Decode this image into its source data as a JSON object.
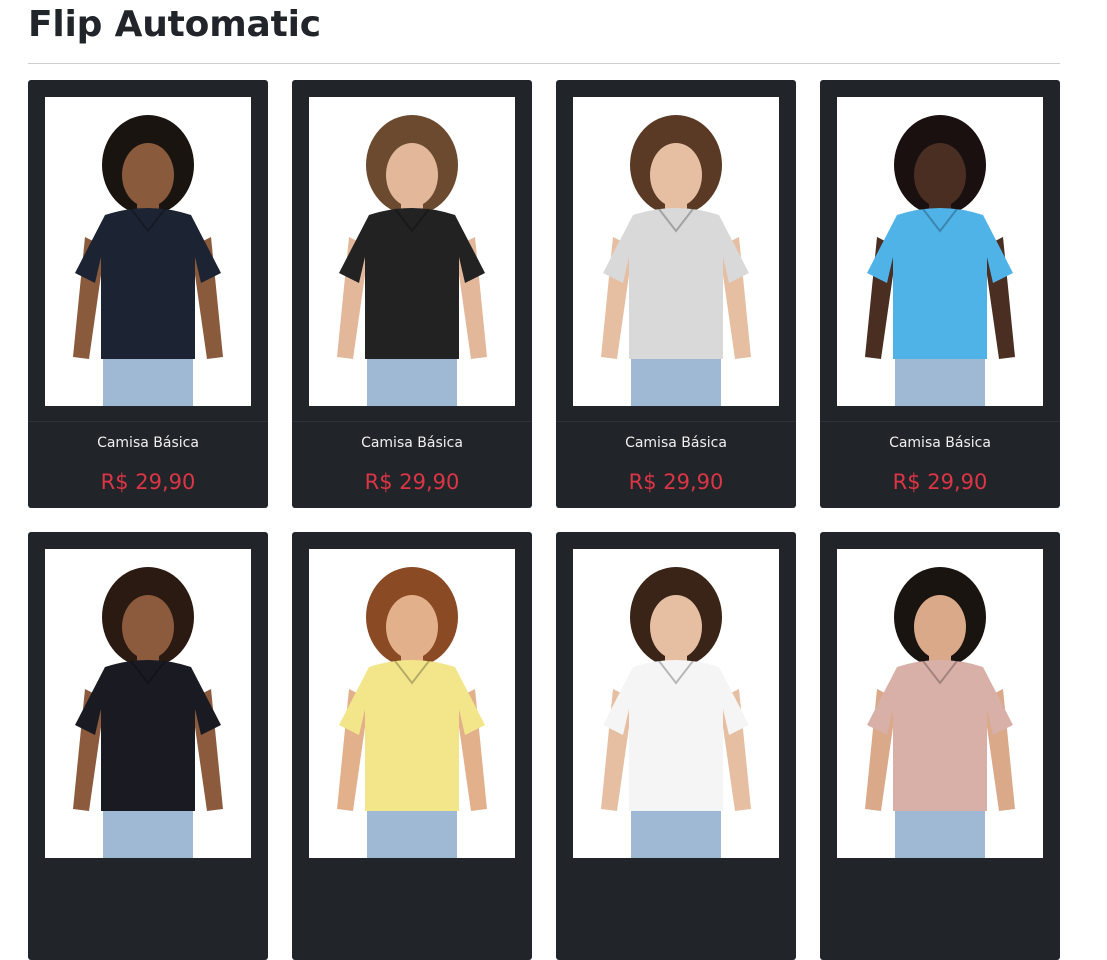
{
  "page": {
    "title": "Flip Automatic"
  },
  "products": [
    {
      "name": "Camisa Básica",
      "price": "R$ 29,90",
      "image": "woman-navy-polo-photo",
      "shirt_color": "#1c2433",
      "skin": "#8a5a3c",
      "hair": "#1a1410"
    },
    {
      "name": "Camisa Básica",
      "price": "R$ 29,90",
      "image": "woman-black-polo-photo",
      "shirt_color": "#222222",
      "skin": "#e3b89a",
      "hair": "#6b4a2f"
    },
    {
      "name": "Camisa Básica",
      "price": "R$ 29,90",
      "image": "woman-gray-polo-photo",
      "shirt_color": "#d9d9d9",
      "skin": "#e6bfa3",
      "hair": "#5a3a24"
    },
    {
      "name": "Camisa Básica",
      "price": "R$ 29,90",
      "image": "man-blue-tshirt-back-photo",
      "shirt_color": "#4fb3e8",
      "skin": "#4a2e22",
      "hair": "#1a1010"
    },
    {
      "name": "",
      "price": "",
      "image": "man-dark-polo-photo",
      "shirt_color": "#1a1a22",
      "skin": "#8c5b3e",
      "hair": "#2a1a12"
    },
    {
      "name": "",
      "price": "",
      "image": "man-yellow-print-tshirt-photo",
      "shirt_color": "#f3e68a",
      "skin": "#e3b08c",
      "hair": "#8a4a24"
    },
    {
      "name": "",
      "price": "",
      "image": "woman-white-print-tshirt-photo",
      "shirt_color": "#f5f5f5",
      "skin": "#e6bfa3",
      "hair": "#3a2418"
    },
    {
      "name": "",
      "price": "",
      "image": "man-pink-print-tshirt-photo",
      "shirt_color": "#d8b0a8",
      "skin": "#d9a98a",
      "hair": "#1a1410"
    }
  ],
  "colors": {
    "card_bg": "#212529",
    "price": "#dc3545",
    "name": "#f0f0f0"
  }
}
